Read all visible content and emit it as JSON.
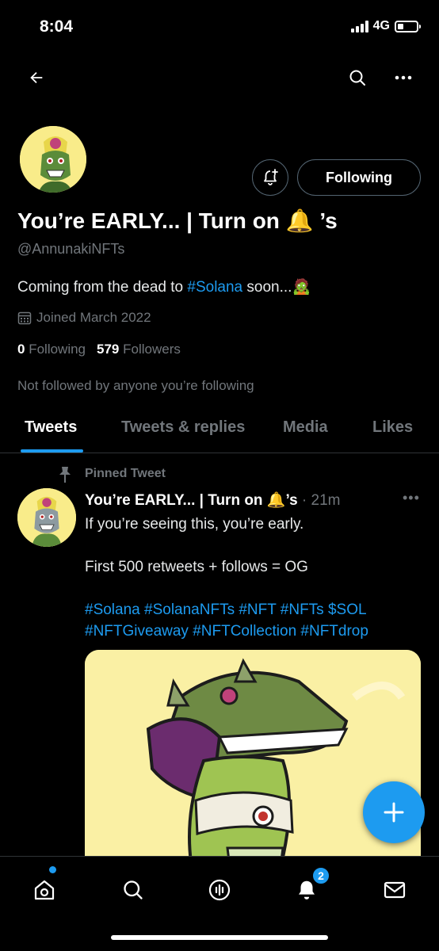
{
  "status_bar": {
    "time": "8:04",
    "network": "4G"
  },
  "profile": {
    "display_name_prefix": "You’re EARLY... | Turn on ",
    "display_name_emoji": "🔔",
    "display_name_suffix": " ’s",
    "handle": "@AnnunakiNFTs",
    "bio_prefix": "Coming from the dead to ",
    "bio_hashtag": "#Solana",
    "bio_suffix": " soon...",
    "bio_emoji": "🧟",
    "joined": "Joined March 2022",
    "following_count": "0",
    "following_label": "Following",
    "followers_count": "579",
    "followers_label": "Followers",
    "not_followed": "Not followed by anyone you’re following",
    "follow_button": "Following"
  },
  "tabs": [
    {
      "label": "Tweets",
      "active": true
    },
    {
      "label": "Tweets & replies",
      "active": false
    },
    {
      "label": "Media",
      "active": false
    },
    {
      "label": "Likes",
      "active": false
    }
  ],
  "pinned_tweet": {
    "pinned_label": "Pinned Tweet",
    "author_name": "You’re EARLY... | Turn on",
    "author_emoji": "🔔",
    "author_suffix": "’s",
    "time": "· 21m",
    "line1": "If you’re seeing this, you’re early.",
    "line2": "First 500 retweets + follows = OG",
    "hashtags_line1": "#Solana #SolanaNFTs #NFT #NFTs $SOL",
    "hashtags_line2": "#NFTGiveaway #NFTCollection #NFTdrop"
  },
  "bottom_nav": {
    "notifications_badge": "2"
  },
  "colors": {
    "accent": "#1d9bf0",
    "background": "#000000",
    "muted": "#71767b",
    "media_bg": "#faf0a4"
  },
  "icons": [
    "back-arrow-icon",
    "search-icon",
    "more-icon",
    "bell-plus-icon",
    "calendar-icon",
    "pin-icon",
    "plus-icon",
    "home-icon",
    "explore-icon",
    "spaces-icon",
    "notifications-icon",
    "messages-icon"
  ]
}
